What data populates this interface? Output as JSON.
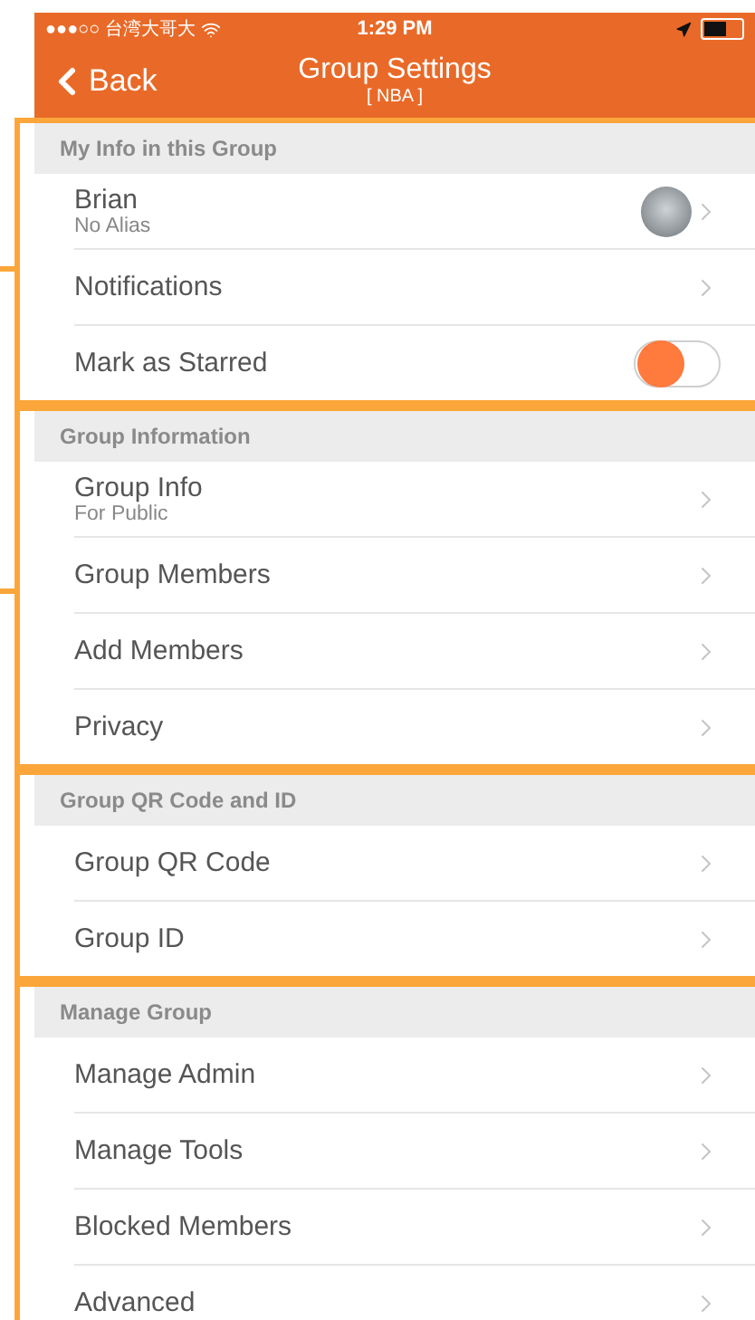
{
  "status_bar": {
    "carrier": "●●●○○ 台湾大哥大",
    "time": "1:29 PM"
  },
  "nav": {
    "back": "Back",
    "title": "Group Settings",
    "subtitle": "[ NBA ]"
  },
  "sections": [
    {
      "header": "My Info in this Group",
      "rows": [
        {
          "kind": "profile",
          "label": "Brian",
          "sublabel": "No Alias"
        },
        {
          "kind": "link",
          "label": "Notifications"
        },
        {
          "kind": "toggle",
          "label": "Mark as Starred",
          "on": false
        }
      ]
    },
    {
      "header": "Group Information",
      "rows": [
        {
          "kind": "link",
          "label": "Group Info",
          "sublabel": "For Public"
        },
        {
          "kind": "link",
          "label": "Group Members"
        },
        {
          "kind": "link",
          "label": "Add Members"
        },
        {
          "kind": "link",
          "label": "Privacy"
        }
      ]
    },
    {
      "header": "Group QR Code and ID",
      "rows": [
        {
          "kind": "link",
          "label": "Group QR Code"
        },
        {
          "kind": "link",
          "label": "Group ID"
        }
      ]
    },
    {
      "header": "Manage Group",
      "rows": [
        {
          "kind": "link",
          "label": "Manage Admin"
        },
        {
          "kind": "link",
          "label": "Manage Tools"
        },
        {
          "kind": "link",
          "label": "Blocked Members"
        },
        {
          "kind": "link",
          "label": "Advanced"
        }
      ]
    }
  ]
}
